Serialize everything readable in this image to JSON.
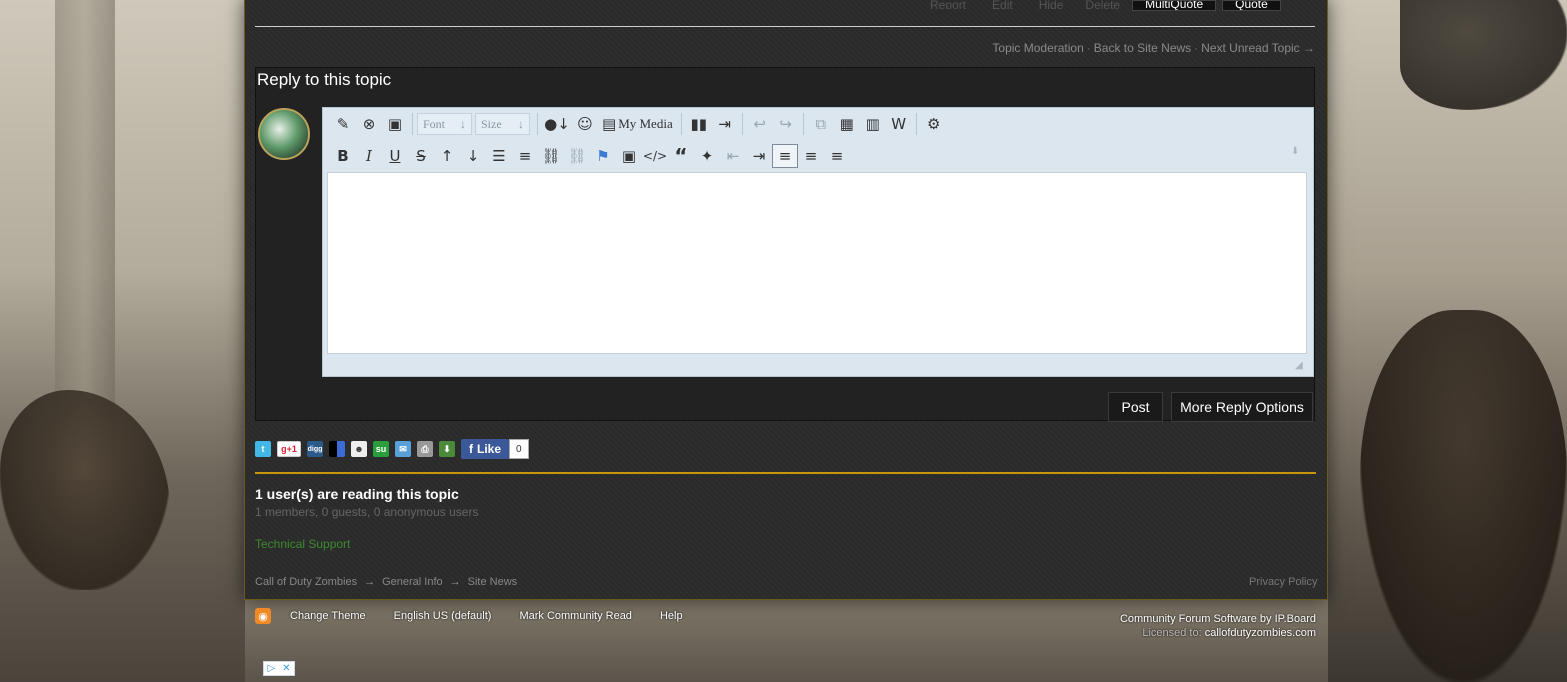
{
  "post_actions": {
    "report": "Report",
    "edit": "Edit",
    "hide": "Hide",
    "delete": "Delete",
    "multiquote": "MultiQuote",
    "quote": "Quote"
  },
  "moderation_links": {
    "topic_moderation": "Topic Moderation",
    "separator": "·",
    "back_to_news": "Back to Site News",
    "next_unread": "Next Unread Topic →"
  },
  "reply": {
    "title": "Reply to this topic",
    "font_placeholder": "Font",
    "size_placeholder": "Size",
    "my_media": "My Media",
    "editor_value": ""
  },
  "toolbar_icons_row1": [
    "remove-format-icon",
    "close-icon",
    "briefcase-icon",
    "font-color-icon",
    "emoticon-icon",
    "my-media-icon",
    "find-icon",
    "source-icon",
    "undo-icon",
    "redo-icon",
    "copy-icon",
    "paste-icon",
    "paste-text-icon",
    "paste-word-icon",
    "settings-icon"
  ],
  "toolbar_icons_row2": [
    "bold-icon",
    "italic-icon",
    "underline-icon",
    "strikethrough-icon",
    "superscript-icon",
    "subscript-icon",
    "bullet-list-icon",
    "numbered-list-icon",
    "link-icon",
    "unlink-icon",
    "special-icon",
    "image-icon",
    "code-icon",
    "quote-icon",
    "twitter-icon",
    "outdent-icon",
    "indent-icon",
    "align-left-icon",
    "align-center-icon",
    "align-right-icon"
  ],
  "buttons": {
    "post": "Post",
    "more_reply_options": "More Reply Options"
  },
  "share": {
    "gplus": "g+1",
    "digg": "digg",
    "like": "Like",
    "like_count": "0"
  },
  "readers": {
    "title": "1 user(s) are reading this topic",
    "subtitle": "1 members, 0 guests, 0 anonymous users",
    "member": "Technical Support"
  },
  "breadcrumb": {
    "item1": "Call of Duty Zombies",
    "item2": "General Info",
    "item3": "Site News",
    "arrow": "→"
  },
  "privacy": "Privacy Policy",
  "footer": {
    "change_theme": "Change Theme",
    "language": "English US (default)",
    "mark_read": "Mark Community Read",
    "help": "Help",
    "software": "Community Forum Software by IP.Board",
    "licensed_label": "Licensed to:",
    "licensed_to": "callofdutyzombies.com"
  },
  "colors": {
    "panel_bg": "#2a2a2a",
    "gold_accent": "#c8960c",
    "member_green": "#3c8a2e",
    "editor_bg": "#dbe6ef",
    "facebook_blue": "#3b5998"
  }
}
